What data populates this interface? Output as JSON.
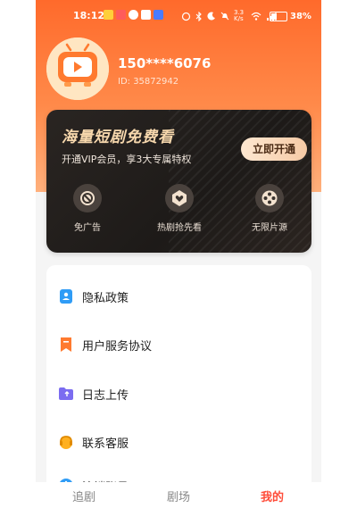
{
  "status_bar": {
    "time": "18:12",
    "speed": "3.3 K/s",
    "battery": "38%"
  },
  "profile": {
    "phone": "150****6076",
    "id_text": "ID: 35872942"
  },
  "vip": {
    "title": "海量短剧免费看",
    "subtitle": "开通VIP会员，享3大专属特权",
    "button": "立即开通",
    "perks": [
      {
        "label": "免广告",
        "icon": "no-ads-icon"
      },
      {
        "label": "热剧抢先看",
        "icon": "heart-badge-icon"
      },
      {
        "label": "无限片源",
        "icon": "film-reel-icon"
      }
    ]
  },
  "menu": {
    "items": [
      {
        "label": "隐私政策",
        "icon": "privacy-doc-icon"
      },
      {
        "label": "用户服务协议",
        "icon": "bookmark-icon"
      },
      {
        "label": "日志上传",
        "icon": "folder-icon"
      },
      {
        "label": "联系客服",
        "icon": "headset-icon"
      },
      {
        "label": "注销账号",
        "icon": "info-icon"
      }
    ]
  },
  "bottom_nav": {
    "tabs": [
      {
        "label": "追剧"
      },
      {
        "label": "剧场"
      },
      {
        "label": "我的"
      }
    ],
    "active": "我的"
  },
  "colors": {
    "accent": "#ff4d3a",
    "header_orange": "#ff6a2b",
    "vip_gold": "#f7d8ad"
  }
}
